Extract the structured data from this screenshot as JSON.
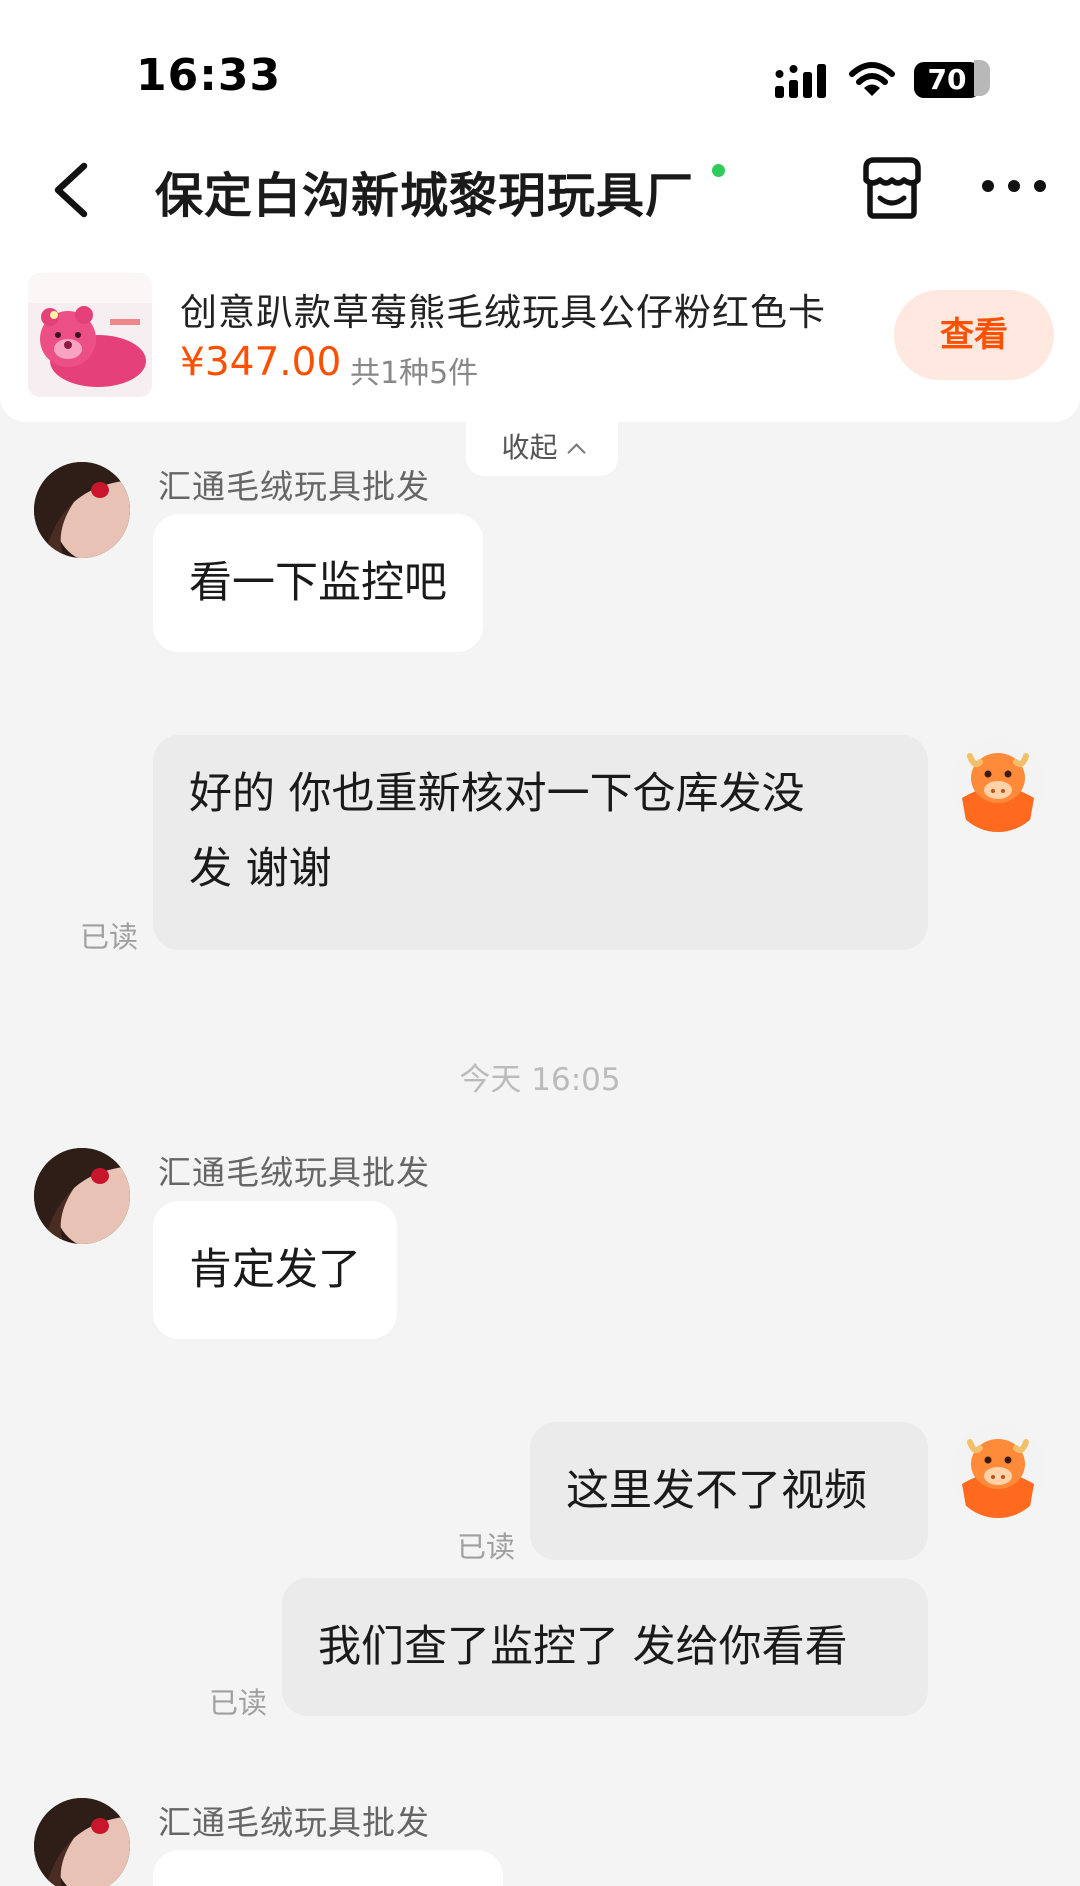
{
  "status_bar": {
    "time": "16:33",
    "battery": "70"
  },
  "nav": {
    "title": "保定白沟新城黎玥玩具厂",
    "back_icon": "chevron-left-icon",
    "shop_icon": "store-icon",
    "more_icon": "more-dots-icon",
    "online_color": "#2ecc5a"
  },
  "product": {
    "title": "创意趴款草莓熊毛绒玩具公仔粉红色卡",
    "price": "¥347.00",
    "quantity": "共1种5件",
    "view_label": "查看",
    "collapse_label": "收起"
  },
  "messages": [
    {
      "sender": "汇通毛绒玩具批发",
      "text": "看一下监控吧"
    },
    {
      "text_line1": "好的 你也重新核对一下仓库发没",
      "text_line2": "发 谢谢",
      "status": "已读"
    },
    {
      "timestamp": "今天 16:05"
    },
    {
      "sender": "汇通毛绒玩具批发",
      "text": "肯定发了"
    },
    {
      "text": "这里发不了视频",
      "status": "已读"
    },
    {
      "text": "我们查了监控了 发给你看看",
      "status": "已读"
    },
    {
      "sender": "汇通毛绒玩具批发"
    }
  ],
  "colors": {
    "accent": "#ff5000",
    "incoming_bubble": "#ffffff",
    "outgoing_bubble": "#ebebeb",
    "background": "#f4f4f4"
  }
}
